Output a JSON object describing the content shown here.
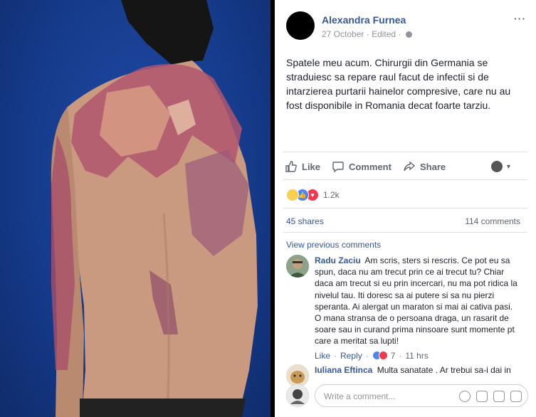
{
  "post": {
    "author": "Alexandra Furnea",
    "date": "27 October",
    "edited": "Edited",
    "text": "Spatele meu acum. Chirurgii din Germania se straduiesc sa repare raul facut de infectii si de intarzierea purtarii hainelor compresive, care nu au fost disponibile in Romania decat foarte tarziu.",
    "more_icon": "···"
  },
  "actions": {
    "like": "Like",
    "comment": "Comment",
    "share": "Share"
  },
  "stats": {
    "reactions": "1.2k",
    "shares": "45 shares",
    "comments": "114 comments"
  },
  "comments_section": {
    "view_previous": "View previous comments",
    "comments": [
      {
        "name": "Radu Zaciu",
        "text": "Am scris, sters si rescris. Ce pot eu sa spun, daca nu am trecut prin ce ai trecut tu? Chiar daca am trecut si eu prin incercari, nu ma pot ridica la nivelul tau. Iti doresc sa ai putere si sa nu pierzi speranta. Ai alergat un maraton si mai ai cativa pasi. O mana stransa de o persoana draga, un rasarit de soare sau in curand prima ninsoare sunt momente pt care a meritat sa lupti!",
        "like": "Like",
        "reply": "Reply",
        "reaction_count": "7",
        "time": "11 hrs"
      },
      {
        "name": "Iuliana Eftinca",
        "text": "Multa sanatate . Ar trebui sa-i dai in"
      }
    ],
    "write_placeholder": "Write a comment..."
  },
  "colors": {
    "link": "#365899",
    "background_photo": "#163b8c"
  }
}
